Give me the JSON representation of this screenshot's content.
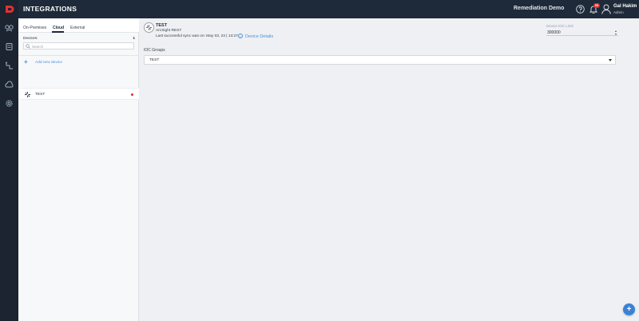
{
  "app": {
    "page_title": "INTEGRATIONS",
    "tenant": "Remediation Demo",
    "notification_count": "99",
    "user": {
      "name": "Gal Hakim",
      "role": "Admin"
    }
  },
  "sidebar": {
    "items": [
      {
        "icon": "integrations-icon"
      },
      {
        "icon": "shield-icon"
      },
      {
        "icon": "flow-icon"
      },
      {
        "icon": "cloud-icon"
      },
      {
        "icon": "gear-icon"
      }
    ]
  },
  "device_panel": {
    "tabs": [
      {
        "label": "On-Premises",
        "active": false
      },
      {
        "label": "Cloud",
        "active": true
      },
      {
        "label": "External",
        "active": false
      }
    ],
    "devices_label": "Devices:",
    "devices_count": "1",
    "search_placeholder": "Search",
    "add_label": "Add new device",
    "devices": [
      {
        "name": "TEST",
        "status_color": "#e03131"
      }
    ]
  },
  "device_detail": {
    "name": "TEST",
    "type": "ArcSight REST",
    "last_sync": "Last successful sync was on: May 03, 23 | 13:27",
    "details_link": "Device Details",
    "ioc_level_label": "Device IOC Limit",
    "ioc_level_value": "300000",
    "ioc_groups_label": "IOC Groups",
    "ioc_groups_value": "TEST"
  },
  "colors": {
    "topbar": "#1e2a39",
    "rail": "#1b2430",
    "accent": "#4a90d9",
    "fab": "#3b82d6",
    "status_red": "#e03131"
  }
}
